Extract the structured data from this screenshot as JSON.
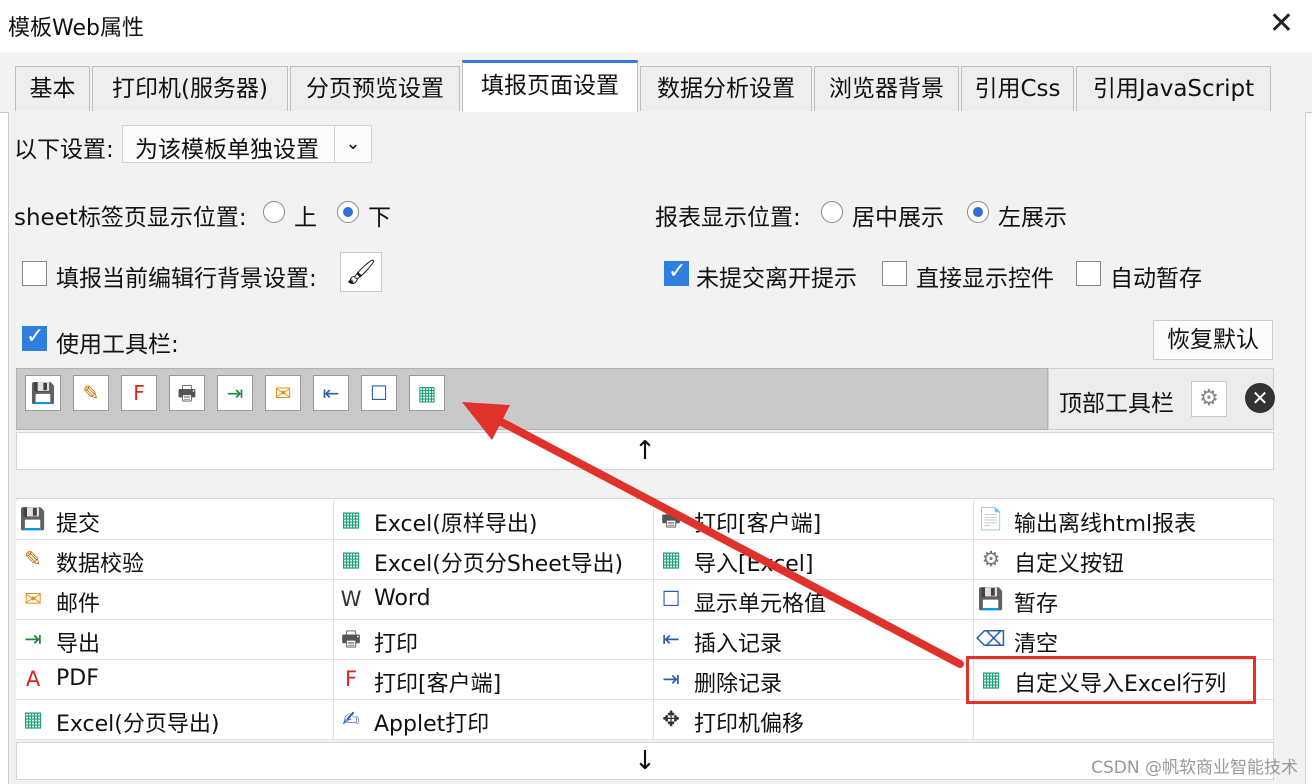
{
  "window": {
    "title": "模板Web属性",
    "close_glyph": "✕"
  },
  "tabs": [
    {
      "label": "基本"
    },
    {
      "label": "打印机(服务器)"
    },
    {
      "label": "分页预览设置"
    },
    {
      "label": "填报页面设置"
    },
    {
      "label": "数据分析设置"
    },
    {
      "label": "浏览器背景"
    },
    {
      "label": "引用Css"
    },
    {
      "label": "引用JavaScript"
    }
  ],
  "active_tab": "填报页面设置",
  "settings": {
    "scope_label": "以下设置:",
    "scope_value": "为该模板单独设置",
    "sheet_label": "sheet标签页显示位置:",
    "sheet_opt_up": "上",
    "sheet_opt_down": "下",
    "report_pos_label": "报表显示位置:",
    "report_opt_center": "居中展示",
    "report_opt_left": "左展示",
    "row_bg_label": "填报当前编辑行背景设置:",
    "unsubmit_label": "未提交离开提示",
    "direct_ctrl_label": "直接显示控件",
    "autosave_label": "自动暂存",
    "use_toolbar_label": "使用工具栏:",
    "restore_label": "恢复默认"
  },
  "toolbar": {
    "position_label": "顶部工具栏",
    "icons": [
      "save-icon",
      "verify-icon",
      "pdf-print-icon",
      "print-icon",
      "export-icon",
      "mail-icon",
      "insert-icon",
      "cell-icon",
      "excel-icon"
    ]
  },
  "arrows": {
    "up": "↑",
    "down": "↓"
  },
  "buttons": [
    {
      "label": "提交",
      "icon": "💾"
    },
    {
      "label": "Excel(原样导出)",
      "icon": "▦"
    },
    {
      "label": "打印[客户端]",
      "icon": "🖶"
    },
    {
      "label": "输出离线html报表",
      "icon": "📄"
    },
    {
      "label": "数据校验",
      "icon": "✎"
    },
    {
      "label": "Excel(分页分Sheet导出)",
      "icon": "▦"
    },
    {
      "label": "导入[Excel]",
      "icon": "▦"
    },
    {
      "label": "自定义按钮",
      "icon": "⚙"
    },
    {
      "label": "邮件",
      "icon": "✉"
    },
    {
      "label": "Word",
      "icon": "W"
    },
    {
      "label": "显示单元格值",
      "icon": "☐"
    },
    {
      "label": "暂存",
      "icon": "💾"
    },
    {
      "label": "导出",
      "icon": "⇥"
    },
    {
      "label": "打印",
      "icon": "🖶"
    },
    {
      "label": "插入记录",
      "icon": "⇤"
    },
    {
      "label": "清空",
      "icon": "⌫"
    },
    {
      "label": "PDF",
      "icon": "A"
    },
    {
      "label": "打印[客户端]",
      "icon": "F"
    },
    {
      "label": "删除记录",
      "icon": "⇥"
    },
    {
      "label": "自定义导入Excel行列",
      "icon": "▦"
    },
    {
      "label": "Excel(分页导出)",
      "icon": "▦"
    },
    {
      "label": "Applet打印",
      "icon": "✍"
    },
    {
      "label": "打印机偏移",
      "icon": "✥"
    },
    {
      "label": "",
      "icon": ""
    }
  ],
  "colors": {
    "accent": "#3a7bd5",
    "highlight": "#e0322b",
    "excel_green": "#1f9e7a"
  },
  "watermark": "CSDN @帆软商业智能技术"
}
